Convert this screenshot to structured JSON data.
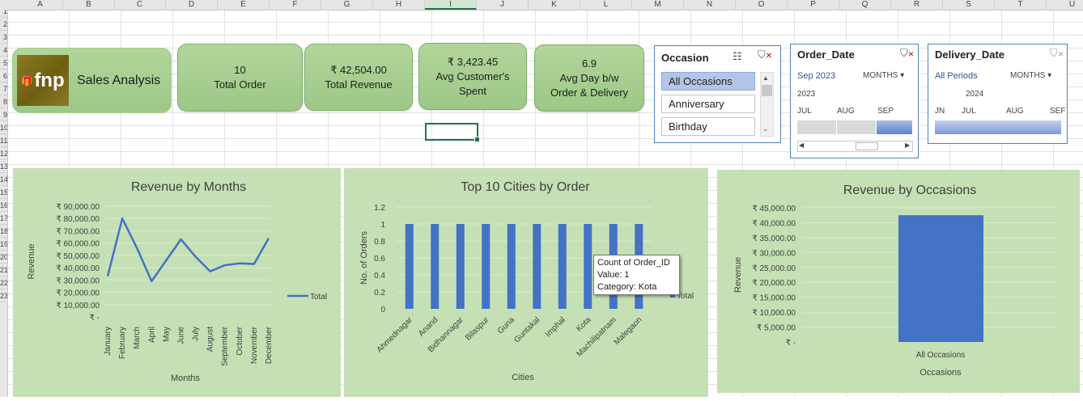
{
  "spreadsheet": {
    "columns": [
      "A",
      "B",
      "C",
      "D",
      "E",
      "F",
      "G",
      "H",
      "I",
      "J",
      "K",
      "L",
      "M",
      "N",
      "O",
      "P",
      "Q",
      "R",
      "S",
      "T",
      "U"
    ],
    "rows": [
      "1",
      "2",
      "3",
      "4",
      "5",
      "6",
      "7",
      "8",
      "9",
      "10",
      "11",
      "12",
      "13",
      "14",
      "15",
      "16",
      "17",
      "18",
      "19",
      "20",
      "21",
      "22",
      "23"
    ],
    "selected_column": "I"
  },
  "brand": {
    "logo_text": "fnp",
    "title": "Sales Analysis"
  },
  "kpis": {
    "total_order": {
      "value": "10",
      "label": "Total Order"
    },
    "total_revenue": {
      "value": "₹ 42,504.00",
      "label": "Total Revenue"
    },
    "avg_spent": {
      "value": "₹ 3,423.45",
      "label1": "Avg Customer's",
      "label2": "Spent"
    },
    "avg_day": {
      "value": "6.9",
      "label1": "Avg Day b/w",
      "label2": "Order & Delivery"
    }
  },
  "occasion_slicer": {
    "title": "Occasion",
    "items": [
      "All Occasions",
      "Anniversary",
      "Birthday"
    ],
    "selected": "All Occasions"
  },
  "order_date_timeline": {
    "title": "Order_Date",
    "selection": "Sep 2023",
    "level": "MONTHS",
    "year": "2023",
    "months": [
      "JUL",
      "AUG",
      "SEP"
    ]
  },
  "delivery_date_timeline": {
    "title": "Delivery_Date",
    "selection": "All Periods",
    "level": "MONTHS",
    "year": "2024",
    "months": [
      "JN",
      "JUL",
      "AUG",
      "SEF"
    ]
  },
  "colors": {
    "series": "#4472c4",
    "chart_bg": "#c5e0b4",
    "card": "#a9d08e",
    "slicer_selected": "#b4c6e7"
  },
  "tooltip": {
    "line1": "Count of Order_ID",
    "line2": "Value: 1",
    "line3": "Category: Kota"
  },
  "chart_data": [
    {
      "type": "line",
      "title": "Revenue by Months",
      "xlabel": "Months",
      "ylabel": "Revenue",
      "categories": [
        "January",
        "February",
        "March",
        "April",
        "May",
        "June",
        "July",
        "August",
        "September",
        "October",
        "November",
        "December"
      ],
      "series": [
        {
          "name": "Total",
          "values": [
            33000,
            80000,
            56000,
            29000,
            46000,
            63000,
            49000,
            37000,
            42000,
            43500,
            43000,
            64000
          ]
        }
      ],
      "ylim": [
        0,
        90000
      ],
      "yticks": [
        "₹ -",
        "₹ 10,000.00",
        "₹ 20,000.00",
        "₹ 30,000.00",
        "₹ 40,000.00",
        "₹ 50,000.00",
        "₹ 60,000.00",
        "₹ 70,000.00",
        "₹ 80,000.00",
        "₹ 90,000.00"
      ],
      "legend": "right"
    },
    {
      "type": "bar",
      "title": "Top 10 Cities by Order",
      "xlabel": "Cities",
      "ylabel": "No. of Orders",
      "categories": [
        "Ahmednagar",
        "Anand",
        "Bidhannagar",
        "Bilaspur",
        "Guna",
        "Guntakal",
        "Imphal",
        "Kota",
        "Machilipatnam",
        "Malegaon"
      ],
      "series": [
        {
          "name": "Total",
          "values": [
            1,
            1,
            1,
            1,
            1,
            1,
            1,
            1,
            1,
            1
          ]
        }
      ],
      "ylim": [
        0,
        1.2
      ],
      "yticks": [
        "0",
        "0.2",
        "0.4",
        "0.6",
        "0.8",
        "1",
        "1.2"
      ],
      "legend": "right"
    },
    {
      "type": "bar",
      "title": "Revenue by Occasions",
      "xlabel": "Occasions",
      "ylabel": "Revenue",
      "categories": [
        "All Occasions"
      ],
      "series": [
        {
          "values": [
            42504
          ]
        }
      ],
      "ylim": [
        0,
        45000
      ],
      "yticks": [
        "₹ -",
        "₹ 5,000.00",
        "₹ 10,000.00",
        "₹ 15,000.00",
        "₹ 20,000.00",
        "₹ 25,000.00",
        "₹ 30,000.00",
        "₹ 35,000.00",
        "₹ 40,000.00",
        "₹ 45,000.00"
      ]
    }
  ]
}
